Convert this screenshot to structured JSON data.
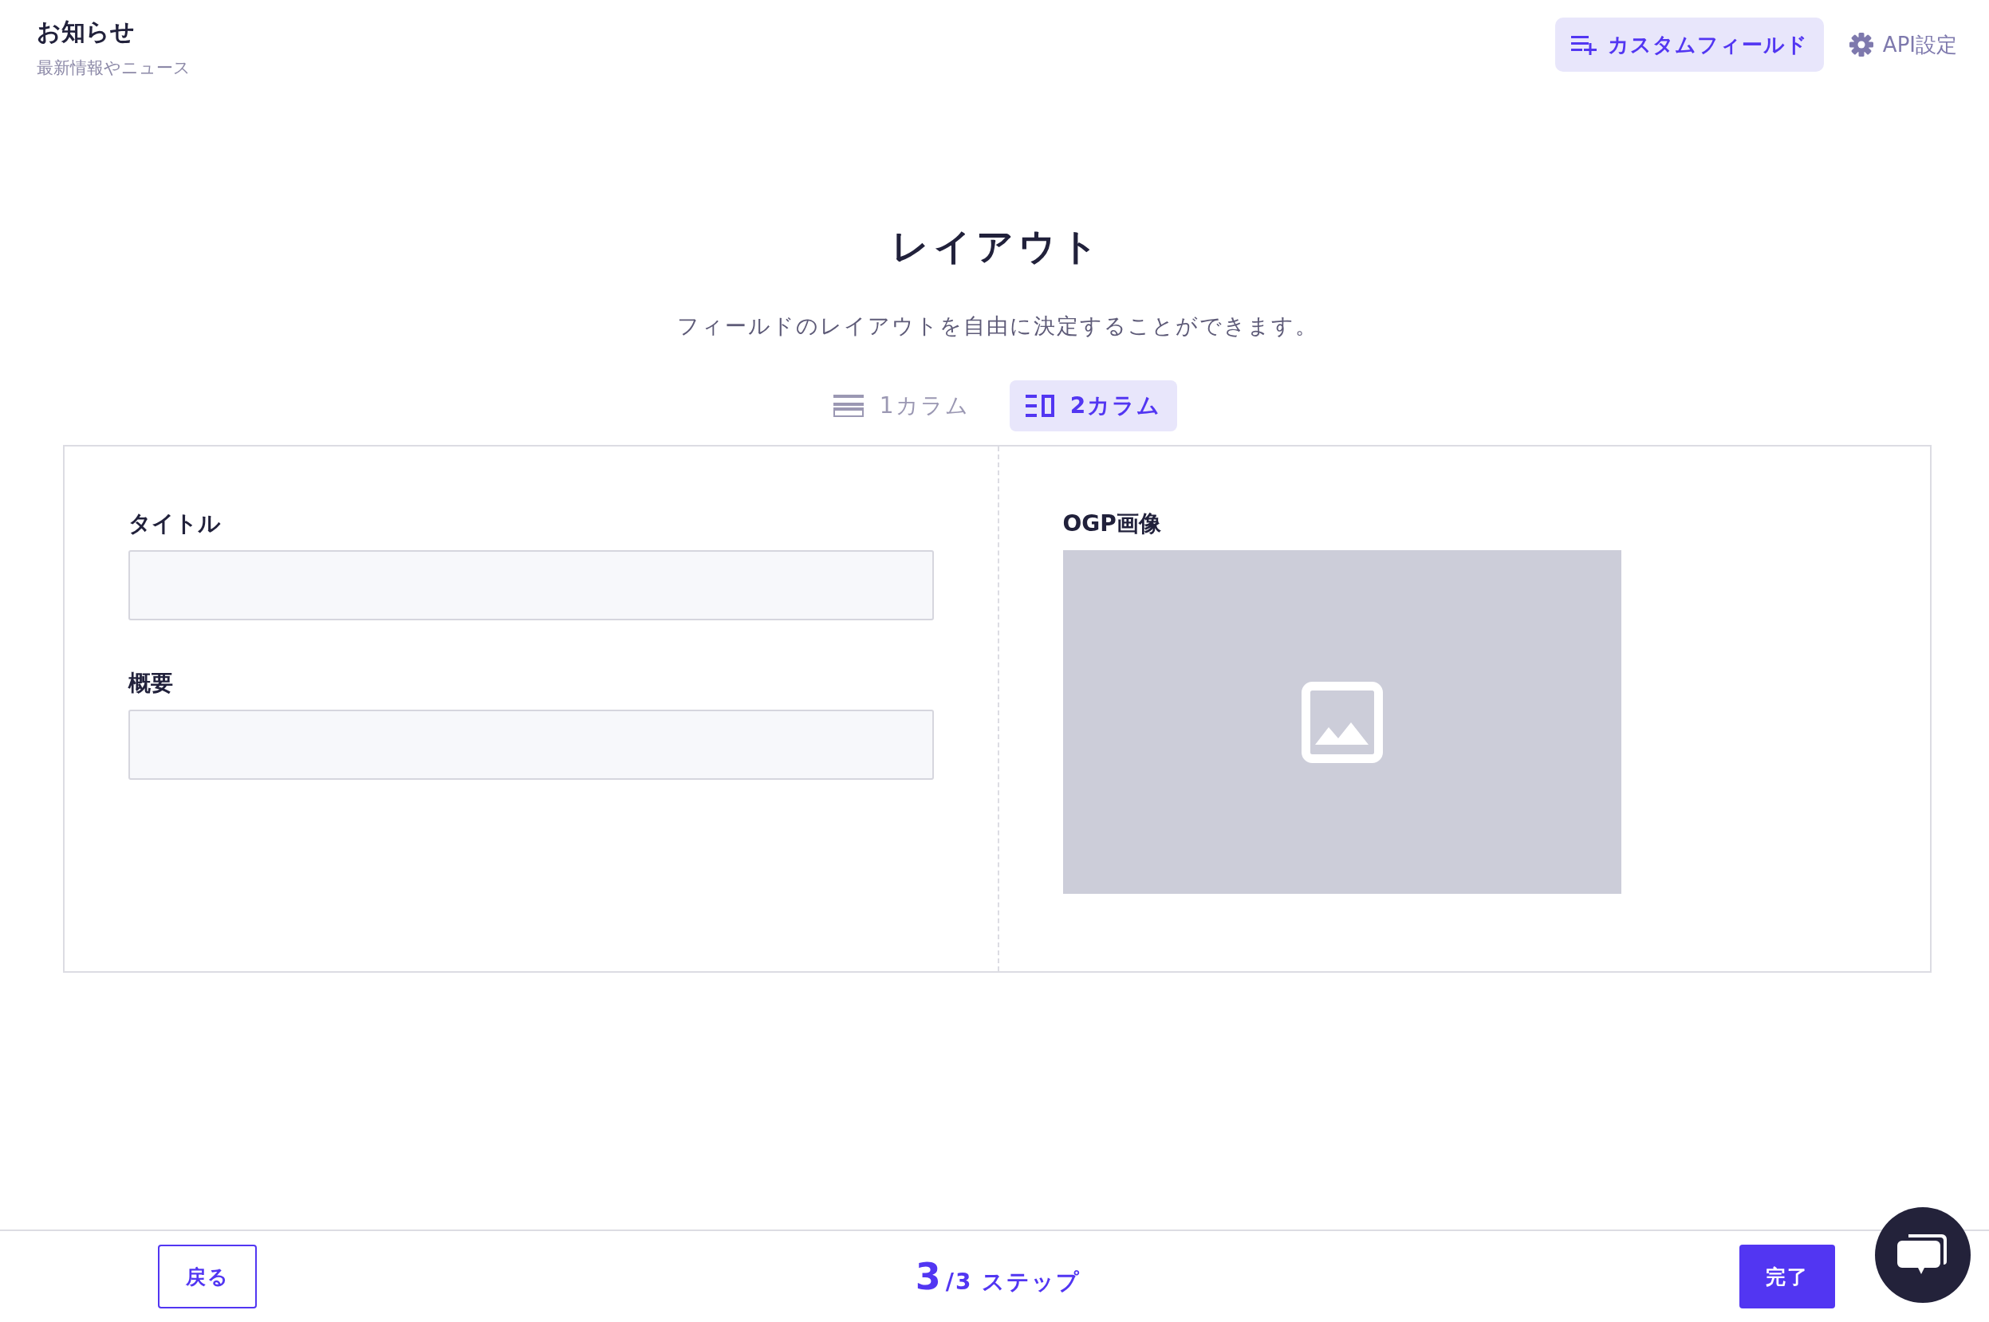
{
  "header": {
    "title": "お知らせ",
    "subtitle": "最新情報やニュース",
    "custom_field_button": "カスタムフィールド",
    "api_settings_link": "API設定"
  },
  "heading": "レイアウト",
  "description": "フィールドのレイアウトを自由に決定することができます。",
  "tabs": [
    {
      "label": "1カラム",
      "kind": "one",
      "selected": false
    },
    {
      "label": "2カラム",
      "kind": "two",
      "selected": true
    }
  ],
  "columns": [
    [
      {
        "label": "タイトル",
        "kind": "text"
      },
      {
        "label": "概要",
        "kind": "text"
      }
    ],
    [
      {
        "label": "OGP画像",
        "kind": "image"
      }
    ]
  ],
  "footer": {
    "back_button": "戻る",
    "step_current": "3",
    "step_total": "/3 ステップ",
    "done_button": "完了"
  }
}
